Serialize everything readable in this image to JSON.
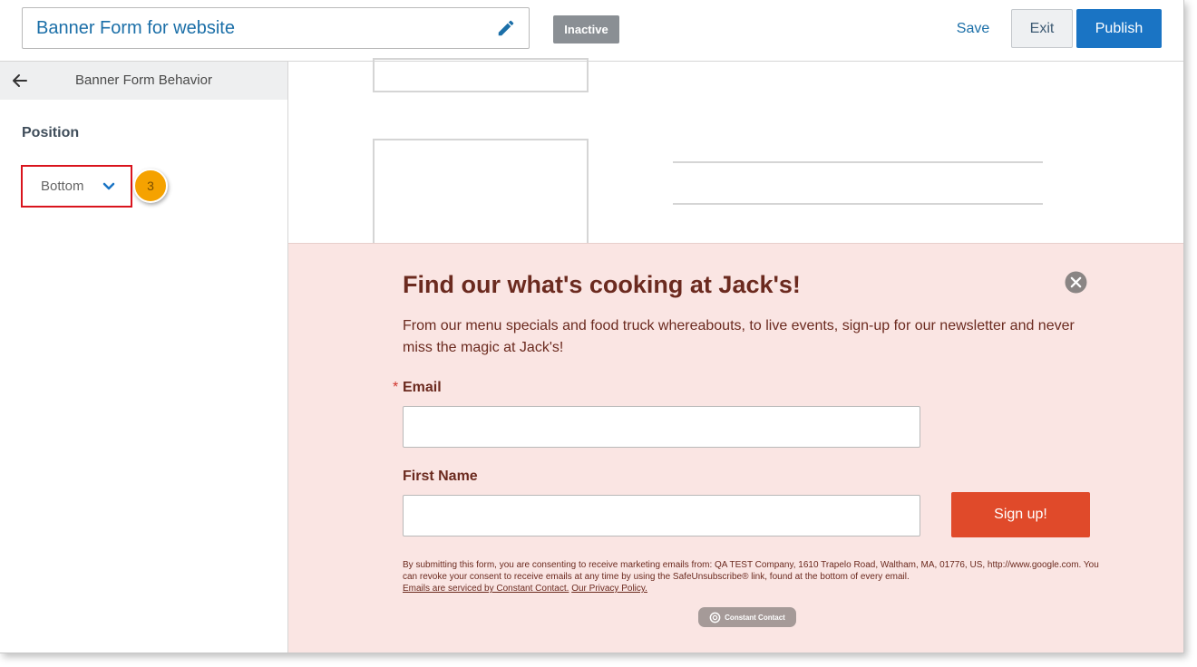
{
  "header": {
    "form_title": "Banner Form for website",
    "status_badge": "Inactive",
    "save_label": "Save",
    "exit_label": "Exit",
    "publish_label": "Publish"
  },
  "sidebar": {
    "title": "Banner Form Behavior",
    "position_label": "Position",
    "position_value": "Bottom",
    "step_number": "3"
  },
  "banner": {
    "title": "Find our what's cooking at Jack's!",
    "description": "From our menu specials and food truck whereabouts, to live events, sign-up for our newsletter and never miss the magic at Jack's!",
    "required_marker": "*",
    "email_label": "Email",
    "email_value": "",
    "first_name_label": "First Name",
    "first_name_value": "",
    "signup_label": "Sign up!",
    "consent_text": "By submitting this form, you are consenting to receive marketing emails from: QA TEST Company, 1610 Trapelo Road, Waltham, MA, 01776, US, http://www.google.com. You can revoke your consent to receive emails at any time by using the SafeUnsubscribe® link, found at the bottom of every email.",
    "consent_link1": "Emails are serviced by Constant Contact.",
    "consent_link2": "Our Privacy Policy.",
    "cc_badge": "Constant Contact"
  },
  "icons": {
    "edit": "pencil-icon",
    "back": "arrow-left-icon",
    "dropdown": "chevron-down-icon",
    "close": "close-circle-icon",
    "cc": "constant-contact-logo-icon"
  },
  "colors": {
    "accent_blue": "#1a74c4",
    "link_blue": "#1b6fa8",
    "banner_bg": "#fae5e3",
    "banner_text": "#6b2a1f",
    "signup_bg": "#e04a2a",
    "highlight_red": "#d9141d",
    "step_orange": "#f5a200"
  }
}
